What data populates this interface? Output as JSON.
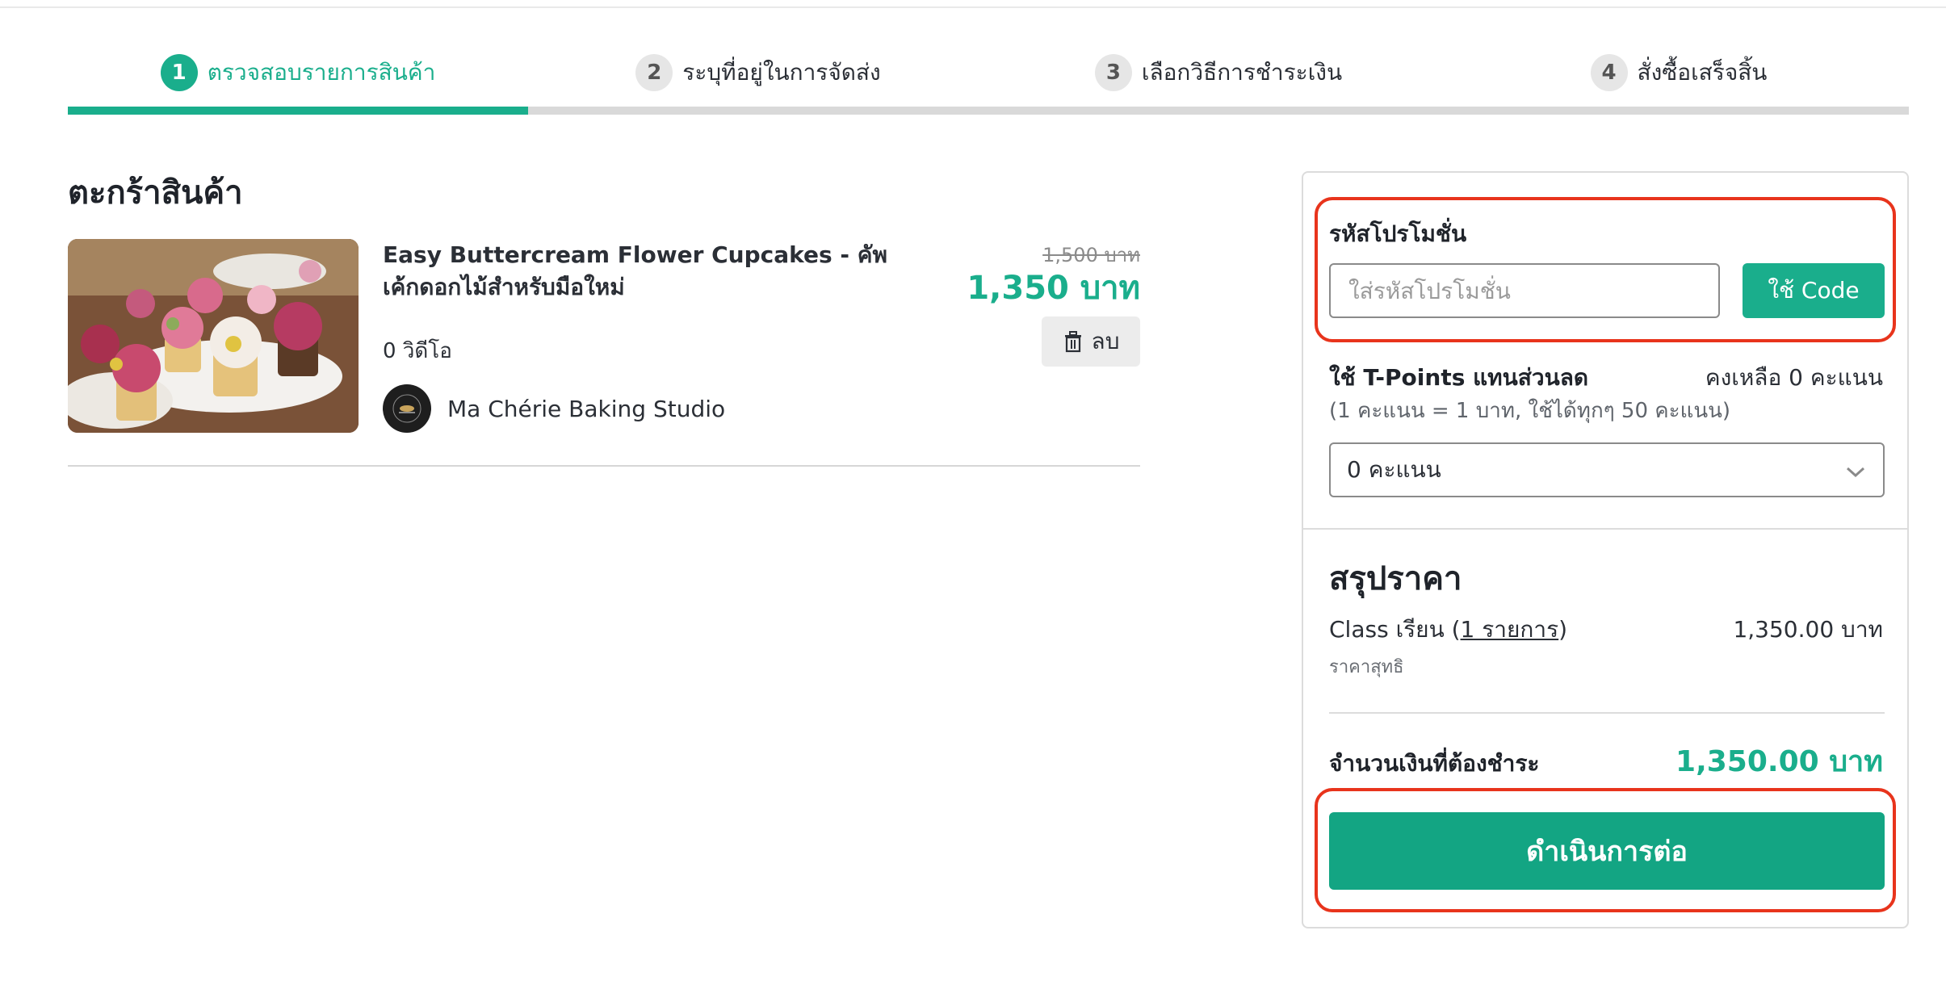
{
  "steps": [
    {
      "num": "1",
      "label": "ตรวจสอบรายการสินค้า",
      "active": true
    },
    {
      "num": "2",
      "label": "ระบุที่อยู่ในการจัดส่ง",
      "active": false
    },
    {
      "num": "3",
      "label": "เลือกวิธีการชำระเงิน",
      "active": false
    },
    {
      "num": "4",
      "label": "สั่งซื้อเสร็จสิ้น",
      "active": false
    }
  ],
  "progress_fraction": 0.25,
  "cart": {
    "title": "ตะกร้าสินค้า",
    "items": [
      {
        "name": "Easy Buttercream Flower Cupcakes - คัพเค้กดอกไม้สำหรับมือใหม่",
        "videos": "0 วิดีโอ",
        "seller": "Ma Chérie Baking Studio",
        "price_old": "1,500 บาท",
        "price_new": "1,350 บาท",
        "delete_label": "ลบ"
      }
    ]
  },
  "promo": {
    "label": "รหัสโปรโมชั่น",
    "placeholder": "ใส่รหัสโปรโมชั่น",
    "button": "ใช้ Code"
  },
  "points": {
    "title": "ใช้ T-Points แทนส่วนลด",
    "remaining": "คงเหลือ 0 คะแนน",
    "note": "(1 คะแนน = 1 บาท, ใช้ได้ทุกๆ 50 คะแนน)",
    "selected": "0 คะแนน"
  },
  "summary": {
    "title": "สรุปราคา",
    "line_prefix": "Class เรียน (",
    "line_link": "1 รายการ",
    "line_suffix": ")",
    "line_value": "1,350.00 บาท",
    "net_label": "ราคาสุทธิ",
    "total_label": "จำนวนเงินที่ต้องชำระ",
    "total_value": "1,350.00 บาท",
    "checkout": "ดำเนินการต่อ"
  },
  "colors": {
    "accent": "#1aae8c",
    "highlight": "#e8341c"
  },
  "icons": {
    "delete": "trash-icon",
    "dropdown": "chevron-down-icon"
  }
}
